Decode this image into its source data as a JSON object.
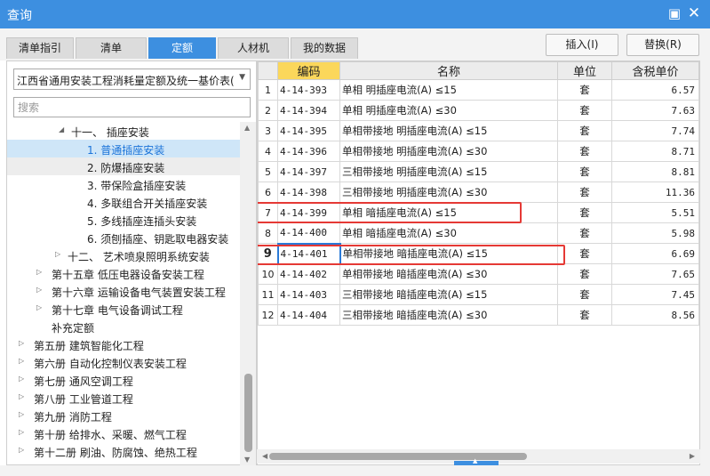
{
  "window": {
    "title": "查询",
    "minimize_glyph": "▣",
    "close_glyph": "✕"
  },
  "tabs": [
    {
      "label": "清单指引",
      "active": false
    },
    {
      "label": "清单",
      "active": false
    },
    {
      "label": "定额",
      "active": true
    },
    {
      "label": "人材机",
      "active": false
    },
    {
      "label": "我的数据",
      "active": false
    }
  ],
  "buttons": {
    "insert": "插入(I)",
    "replace": "替换(R)"
  },
  "library_select": {
    "value": "江西省通用安装工程消耗量定额及统一基价表("
  },
  "search": {
    "placeholder": "搜索"
  },
  "tree": [
    {
      "label": "十一、 插座安装",
      "arrow": "◢",
      "state": ""
    },
    {
      "label": "1. 普通插座安装",
      "arrow": "",
      "state": "sel"
    },
    {
      "label": "2. 防爆插座安装",
      "arrow": "",
      "state": "hov"
    },
    {
      "label": "3. 带保险盒插座安装",
      "arrow": "",
      "state": ""
    },
    {
      "label": "4. 多联组合开关插座安装",
      "arrow": "",
      "state": ""
    },
    {
      "label": "5. 多线插座连插头安装",
      "arrow": "",
      "state": ""
    },
    {
      "label": "6. 须刨插座、钥匙取电器安装",
      "arrow": "",
      "state": ""
    },
    {
      "label": "十二、 艺术喷泉照明系统安装",
      "arrow": "▷",
      "state": ""
    },
    {
      "label": "第十五章 低压电器设备安装工程",
      "arrow": "▷",
      "state": ""
    },
    {
      "label": "第十六章 运输设备电气装置安装工程",
      "arrow": "▷",
      "state": ""
    },
    {
      "label": "第十七章 电气设备调试工程",
      "arrow": "▷",
      "state": ""
    },
    {
      "label": "补充定额",
      "arrow": "",
      "state": ""
    },
    {
      "label": "第五册 建筑智能化工程",
      "arrow": "▷",
      "state": ""
    },
    {
      "label": "第六册 自动化控制仪表安装工程",
      "arrow": "▷",
      "state": ""
    },
    {
      "label": "第七册 通风空调工程",
      "arrow": "▷",
      "state": ""
    },
    {
      "label": "第八册 工业管道工程",
      "arrow": "▷",
      "state": ""
    },
    {
      "label": "第九册 消防工程",
      "arrow": "▷",
      "state": ""
    },
    {
      "label": "第十册 给排水、采暖、燃气工程",
      "arrow": "▷",
      "state": ""
    },
    {
      "label": "第十二册 刷油、防腐蚀、绝热工程",
      "arrow": "▷",
      "state": ""
    }
  ],
  "table": {
    "headers": {
      "code": "编码",
      "name": "名称",
      "unit": "单位",
      "price": "含税单价"
    },
    "rows": [
      {
        "idx": "1",
        "code": "4-14-393",
        "name": "单相 明插座电流(A) ≤15",
        "unit": "套",
        "price": "6.57"
      },
      {
        "idx": "2",
        "code": "4-14-394",
        "name": "单相 明插座电流(A) ≤30",
        "unit": "套",
        "price": "7.63"
      },
      {
        "idx": "3",
        "code": "4-14-395",
        "name": "单相带接地 明插座电流(A) ≤15",
        "unit": "套",
        "price": "7.74"
      },
      {
        "idx": "4",
        "code": "4-14-396",
        "name": "单相带接地 明插座电流(A) ≤30",
        "unit": "套",
        "price": "8.71"
      },
      {
        "idx": "5",
        "code": "4-14-397",
        "name": "三相带接地 明插座电流(A) ≤15",
        "unit": "套",
        "price": "8.81"
      },
      {
        "idx": "6",
        "code": "4-14-398",
        "name": "三相带接地 明插座电流(A) ≤30",
        "unit": "套",
        "price": "11.36"
      },
      {
        "idx": "7",
        "code": "4-14-399",
        "name": "单相 暗插座电流(A) ≤15",
        "unit": "套",
        "price": "5.51"
      },
      {
        "idx": "8",
        "code": "4-14-400",
        "name": "单相 暗插座电流(A) ≤30",
        "unit": "套",
        "price": "5.98"
      },
      {
        "idx": "9",
        "code": "4-14-401",
        "name": "单相带接地 暗插座电流(A) ≤15",
        "unit": "套",
        "price": "6.69"
      },
      {
        "idx": "10",
        "code": "4-14-402",
        "name": "单相带接地 暗插座电流(A) ≤30",
        "unit": "套",
        "price": "7.65"
      },
      {
        "idx": "11",
        "code": "4-14-403",
        "name": "三相带接地 暗插座电流(A) ≤15",
        "unit": "套",
        "price": "7.45"
      },
      {
        "idx": "12",
        "code": "4-14-404",
        "name": "三相带接地 暗插座电流(A) ≤30",
        "unit": "套",
        "price": "8.56"
      }
    ],
    "current_row": "9",
    "highlighted_rows": [
      "7",
      "9"
    ]
  },
  "colors": {
    "accent": "#3d8fe0",
    "code_header": "#fbd75b",
    "highlight": "#e53935",
    "tree_selected": "#cfe6f8"
  }
}
